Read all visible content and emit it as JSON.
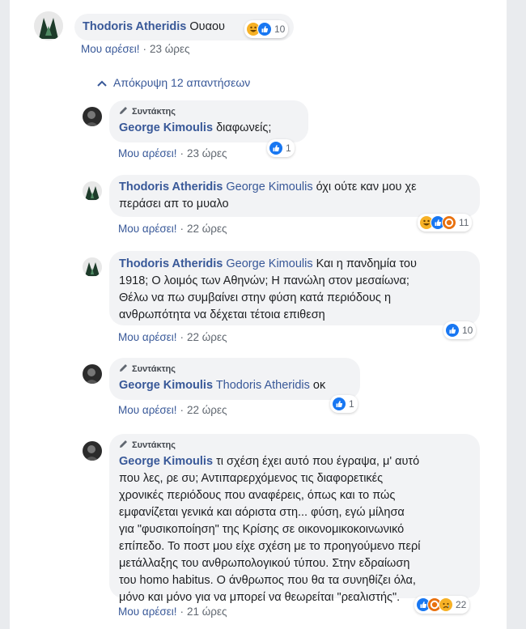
{
  "top_comment": {
    "author": "Thodoris Atheridis",
    "text": "Ουαου",
    "reaction_count": "10",
    "like_label": "Μου αρέσει!",
    "separator": "·",
    "time": "23 ώρες"
  },
  "replies_toggle": "Απόκρυψη 12 απαντήσεων",
  "badge_label": "Συντάκτης",
  "replies": [
    {
      "author": "George Kimoulis",
      "mention": "",
      "text": "διαφωνείς;",
      "reaction_count": "1",
      "like_label": "Μου αρέσει!",
      "separator": "·",
      "time": "23 ώρες"
    },
    {
      "author": "Thodoris Atheridis",
      "mention": "George Kimoulis",
      "text_line1": "όχι ούτε καν μου χε",
      "text_line2": "περάσει απ το μυαλο",
      "reaction_count": "11",
      "like_label": "Μου αρέσει!",
      "separator": "·",
      "time": "22 ώρες"
    },
    {
      "author": "Thodoris Atheridis",
      "mention": "George Kimoulis",
      "text_line1": "Και η πανδημία του",
      "text_rest": [
        "1918; Ο λοιμός των Αθηνών; Η πανώλη στον μεσαίωνα;",
        "Θέλω να πω συμβαίνει στην φύση κατά περιόδους η",
        "ανθρωπότητα να δέχεται τέτοια επιθεση"
      ],
      "reaction_count": "10",
      "like_label": "Μου αρέσει!",
      "separator": "·",
      "time": "22 ώρες"
    },
    {
      "author": "George Kimoulis",
      "mention": "Thodoris Atheridis",
      "text": "οκ",
      "reaction_count": "1",
      "like_label": "Μου αρέσει!",
      "separator": "·",
      "time": "22 ώρες"
    },
    {
      "author": "George Kimoulis",
      "mention": "",
      "text_line1": "τι σχέση έχει αυτό που έγραψα, μ' αυτό",
      "text_rest": [
        "που λες, ρε συ; Αντιπαρερχόμενος τις διαφορετικές",
        "χρονικές περιόδους που αναφέρεις, όπως και το πώς",
        "εμφανίζεται γενικά και αόριστα στη... φύση, εγώ μίλησα",
        "για \"φυσικοποίηση\" της Κρίσης σε οικονομικοκοινωνικό",
        "επίπεδο. Το ποστ μου είχε σχέση με το προηγούμενο περί",
        "μετάλλαξης του ανθρωπολογικού τύπου. Στην εδραίωση",
        "του homo habitus. Ο άνθρωπος που θα τα συνηθίζει όλα,",
        "μόνο και μόνο για να μπορεί να θεωρείται \"ρεαλιστής\"."
      ],
      "reaction_count": "22",
      "like_label": "Μου αρέσει!",
      "separator": "·",
      "time": "21 ώρες"
    }
  ],
  "colors": {
    "link": "#385898",
    "like": "#1877f2",
    "haha": "#f7b125",
    "angry": "#e9710f",
    "love": "#f33e58"
  }
}
